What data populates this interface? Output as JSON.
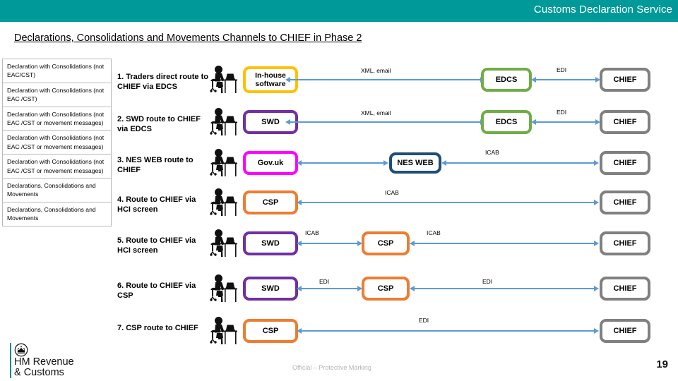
{
  "header": {
    "title": "Customs Declaration Service",
    "bar_color": "#009999"
  },
  "slide": {
    "title": "Declarations, Consolidations and Movements Channels to CHIEF in Phase 2"
  },
  "table": {
    "rows": [
      {
        "message_types": "Declaration with Consolidations (not EAC/CST)"
      },
      {
        "message_types": "Declaration with Consolidations (not EAC /CST)"
      },
      {
        "message_types": "Declaration with Consolidations (not EAC /CST or movement messages)"
      },
      {
        "message_types": "Declaration with Consolidations (not EAC /CST or movement messages)"
      },
      {
        "message_types": "Declaration with Consolidations (not EAC /CST or movement messages)"
      },
      {
        "message_types": "Declarations, Consolidations and Movements"
      },
      {
        "message_types": "Declarations, Consolidations and Movements"
      }
    ]
  },
  "routes": [
    {
      "label": "1. Traders direct route to CHIEF via EDCS",
      "actor_icon": "person-at-desk-icon",
      "nodes": [
        {
          "name": "In-house software",
          "color": "#FFC000",
          "style": "yellow"
        },
        {
          "name": "EDCS",
          "color": "#70AD47",
          "style": "green"
        },
        {
          "name": "CHIEF",
          "color": "#808080",
          "style": "grey"
        }
      ],
      "connector_labels": [
        "XML, email",
        "EDI"
      ]
    },
    {
      "label": "2. SWD route to CHIEF via EDCS",
      "actor_icon": "person-at-desk-icon",
      "nodes": [
        {
          "name": "SWD",
          "color": "#7030A0",
          "style": "purple"
        },
        {
          "name": "EDCS",
          "color": "#70AD47",
          "style": "green"
        },
        {
          "name": "CHIEF",
          "color": "#808080",
          "style": "grey"
        }
      ],
      "connector_labels": [
        "XML, email",
        "EDI"
      ]
    },
    {
      "label": "3. NES WEB route to CHIEF",
      "actor_icon": "person-at-desk-icon",
      "nodes": [
        {
          "name": "Gov.uk",
          "color": "#FF00FF",
          "style": "magenta"
        },
        {
          "name": "NES WEB",
          "color": "#1F4E79",
          "style": "navy"
        },
        {
          "name": "CHIEF",
          "color": "#808080",
          "style": "grey"
        }
      ],
      "connector_labels": [
        "",
        "ICAB"
      ]
    },
    {
      "label": "4. Route to CHIEF via HCI screen",
      "actor_icon": "person-at-desk-icon",
      "nodes": [
        {
          "name": "CSP",
          "color": "#ED7D31",
          "style": "orange"
        },
        {
          "name": "CHIEF",
          "color": "#808080",
          "style": "grey"
        }
      ],
      "connector_labels": [
        "ICAB"
      ]
    },
    {
      "label": "5. Route to CHIEF via HCI screen",
      "actor_icon": "person-at-desk-icon",
      "nodes": [
        {
          "name": "SWD",
          "color": "#7030A0",
          "style": "purple"
        },
        {
          "name": "CSP",
          "color": "#ED7D31",
          "style": "orange"
        },
        {
          "name": "CHIEF",
          "color": "#808080",
          "style": "grey"
        }
      ],
      "connector_labels": [
        "ICAB",
        "ICAB"
      ]
    },
    {
      "label": "6. Route to CHIEF via CSP",
      "actor_icon": "person-at-desk-icon",
      "nodes": [
        {
          "name": "SWD",
          "color": "#7030A0",
          "style": "purple"
        },
        {
          "name": "CSP",
          "color": "#ED7D31",
          "style": "orange"
        },
        {
          "name": "CHIEF",
          "color": "#808080",
          "style": "grey"
        }
      ],
      "connector_labels": [
        "EDI",
        "EDI"
      ]
    },
    {
      "label": "7. CSP route to CHIEF",
      "actor_icon": "person-at-desk-icon",
      "nodes": [
        {
          "name": "CSP",
          "color": "#ED7D31",
          "style": "orange"
        },
        {
          "name": "CHIEF",
          "color": "#808080",
          "style": "grey"
        }
      ],
      "connector_labels": [
        "EDI"
      ]
    }
  ],
  "footer": {
    "logo_text": "HM Revenue\n& Customs",
    "logo_icon": "crown-icon",
    "protective_marking": "Official – Protective Marking",
    "page_number": "19"
  }
}
